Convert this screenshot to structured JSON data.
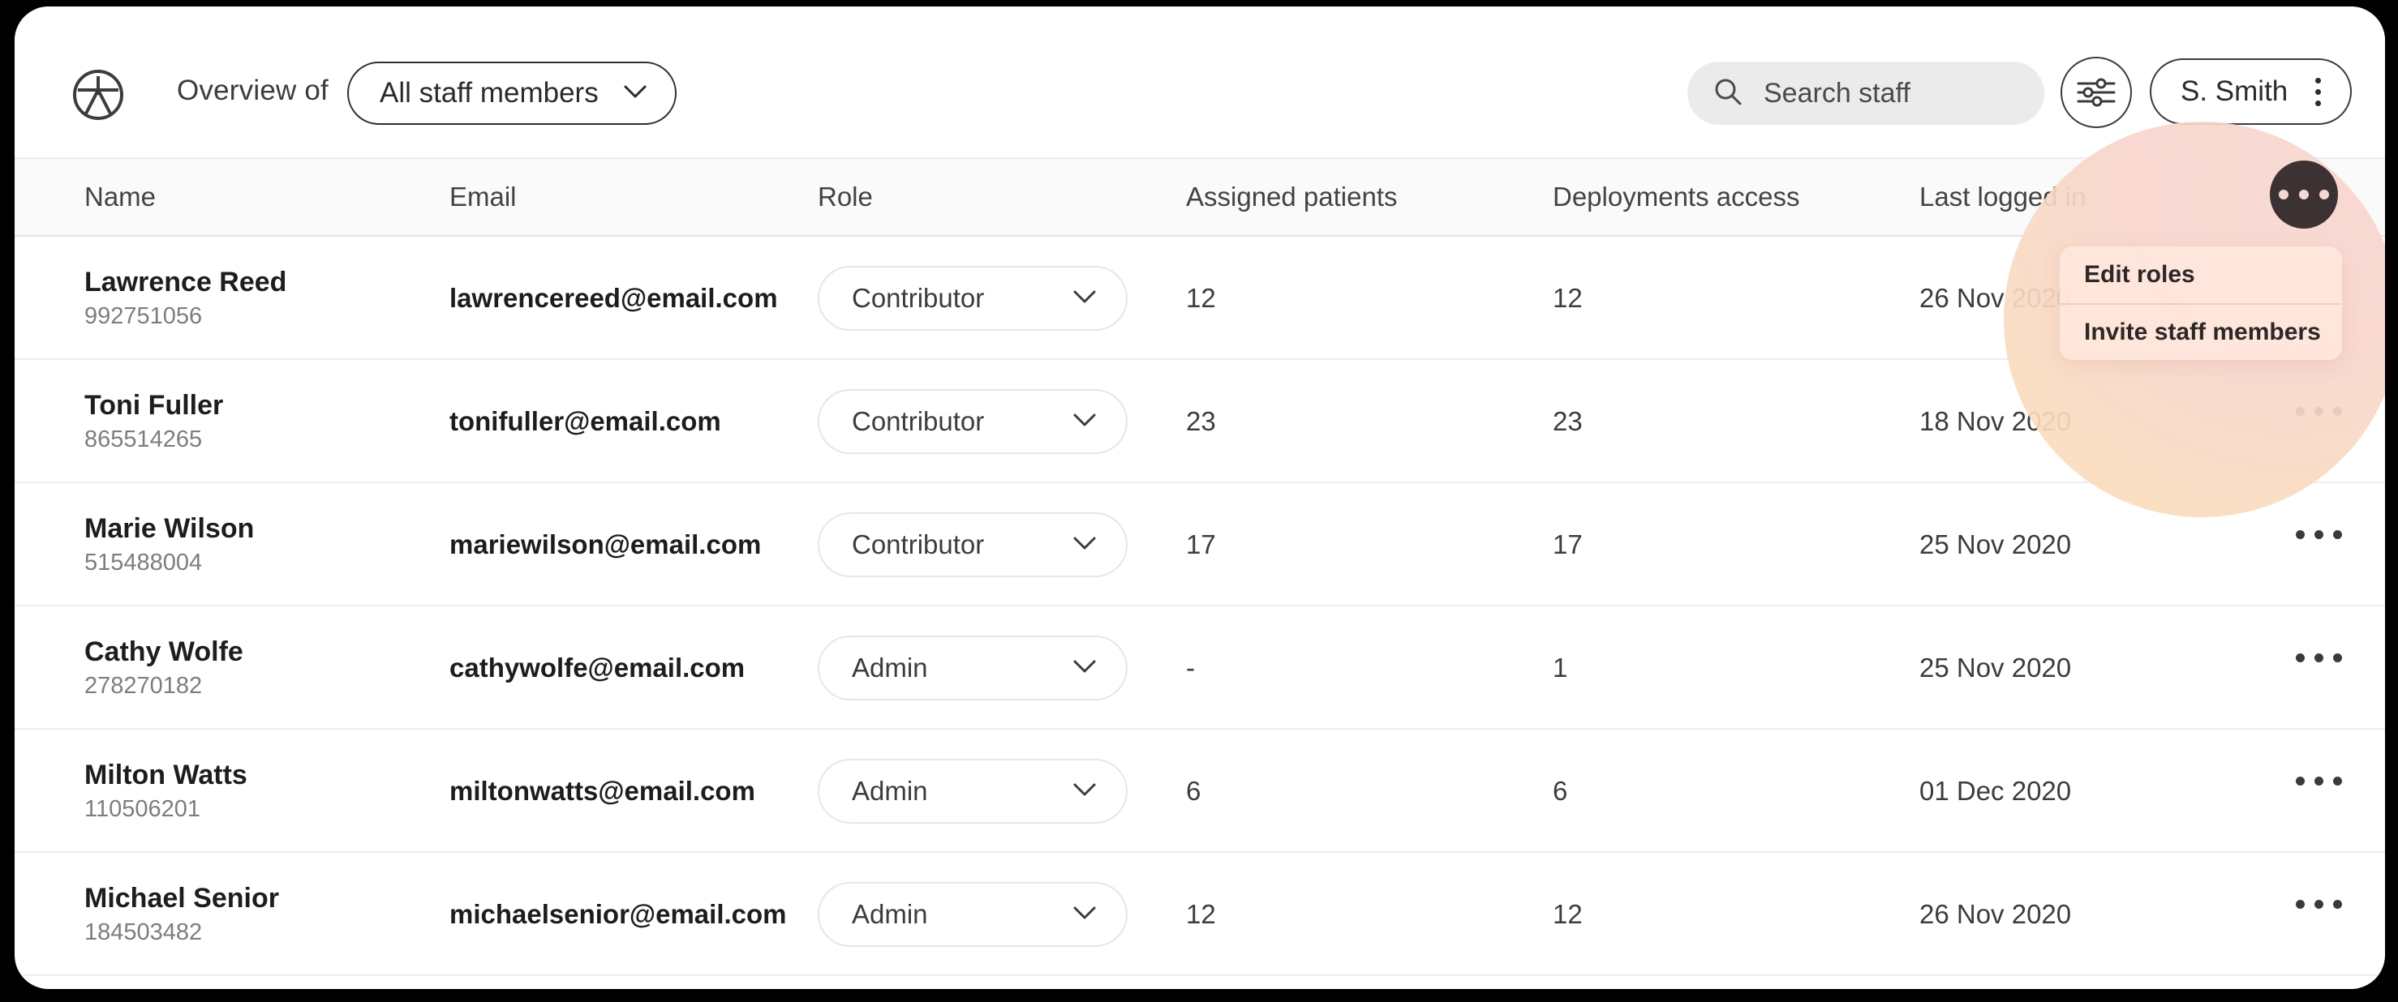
{
  "topbar": {
    "logo_icon": "person-circle-logo-icon",
    "overview_label": "Overview of",
    "scope_value": "All staff members",
    "scope_chevron_icon": "chevron-down-icon",
    "search_icon": "search-icon",
    "search_placeholder": "Search staff",
    "search_value": "",
    "filter_icon": "sliders-filter-icon",
    "account_name": "S. Smith",
    "account_menu_icon": "vertical-dots-icon"
  },
  "table": {
    "columns": [
      "Name",
      "Email",
      "Role",
      "Assigned patients",
      "Deployments access",
      "Last logged in"
    ],
    "row_menu_icon": "horizontal-dots-icon",
    "role_chevron_icon": "chevron-down-icon",
    "rows": [
      {
        "name": "Lawrence Reed",
        "id": "992751056",
        "email": "lawrencereed@email.com",
        "role": "Contributor",
        "assigned_patients": "12",
        "deployments_access": "12",
        "last_logged_in": "26 Nov 2020"
      },
      {
        "name": "Toni Fuller",
        "id": "865514265",
        "email": "tonifuller@email.com",
        "role": "Contributor",
        "assigned_patients": "23",
        "deployments_access": "23",
        "last_logged_in": "18 Nov 2020"
      },
      {
        "name": "Marie Wilson",
        "id": "515488004",
        "email": "mariewilson@email.com",
        "role": "Contributor",
        "assigned_patients": "17",
        "deployments_access": "17",
        "last_logged_in": "25 Nov 2020"
      },
      {
        "name": "Cathy Wolfe",
        "id": "278270182",
        "email": "cathywolfe@email.com",
        "role": "Admin",
        "assigned_patients": "-",
        "deployments_access": "1",
        "last_logged_in": "25 Nov 2020"
      },
      {
        "name": "Milton Watts",
        "id": "110506201",
        "email": "miltonwatts@email.com",
        "role": "Admin",
        "assigned_patients": "6",
        "deployments_access": "6",
        "last_logged_in": "01 Dec 2020"
      },
      {
        "name": "Michael Senior",
        "id": "184503482",
        "email": "michaelsenior@email.com",
        "role": "Admin",
        "assigned_patients": "12",
        "deployments_access": "12",
        "last_logged_in": "26 Nov 2020"
      }
    ]
  },
  "popup_menu": {
    "trigger_icon": "horizontal-dots-icon",
    "items": [
      "Edit roles",
      "Invite staff members"
    ]
  },
  "colors": {
    "page_background": "#000000",
    "card_background": "#FFFFFF",
    "header_band": "#FAFAFA",
    "row_divider": "#EDEDED",
    "search_field": "#EBEBEB",
    "menu_button": "#3C3234",
    "highlight_pink": "#F8D5CD",
    "highlight_orange": "#FBDFB6",
    "popup_background": "#FFE8DE",
    "text_primary": "#1D1D1D",
    "text_secondary": "#7D7D7D"
  }
}
